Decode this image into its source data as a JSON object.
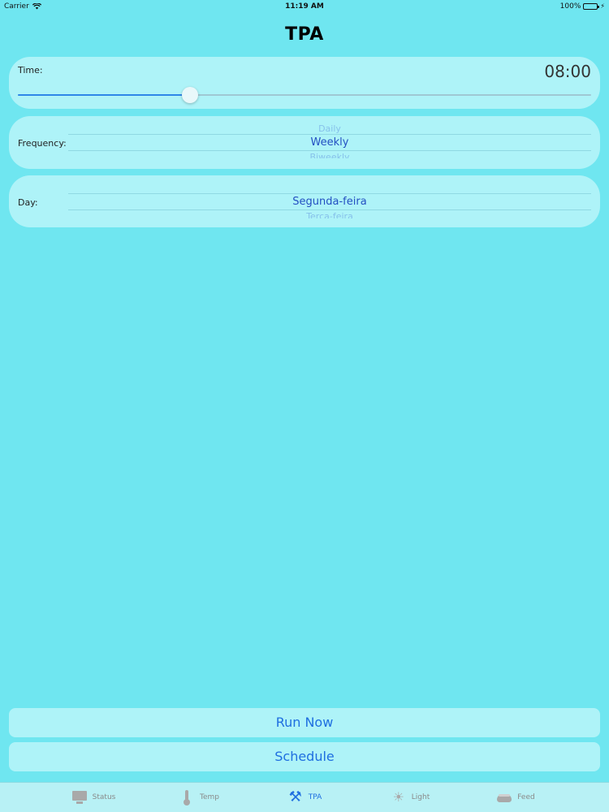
{
  "status_bar": {
    "carrier": "Carrier",
    "time": "11:19 AM",
    "battery": "100%"
  },
  "header": {
    "title": "TPA"
  },
  "time_card": {
    "label": "Time:",
    "value": "08:00",
    "slider_fraction": 0.3
  },
  "frequency_card": {
    "label": "Frequency:",
    "options": [
      "Daily",
      "Weekly",
      "Biweekly"
    ],
    "selected": "Weekly"
  },
  "day_card": {
    "label": "Day:",
    "options": [
      "Segunda-feira",
      "Terça-feira"
    ],
    "selected": "Segunda-feira"
  },
  "buttons": {
    "run_now": "Run Now",
    "schedule": "Schedule"
  },
  "tab_bar": {
    "items": [
      {
        "label": "Status",
        "icon": "monitor-icon"
      },
      {
        "label": "Temp",
        "icon": "thermometer-icon"
      },
      {
        "label": "TPA",
        "icon": "tools-icon"
      },
      {
        "label": "Light",
        "icon": "sun-icon"
      },
      {
        "label": "Feed",
        "icon": "food-dish-icon"
      }
    ],
    "active": "TPA"
  },
  "colors": {
    "background": "#6fe6f0",
    "accent": "#1f6fe0"
  }
}
